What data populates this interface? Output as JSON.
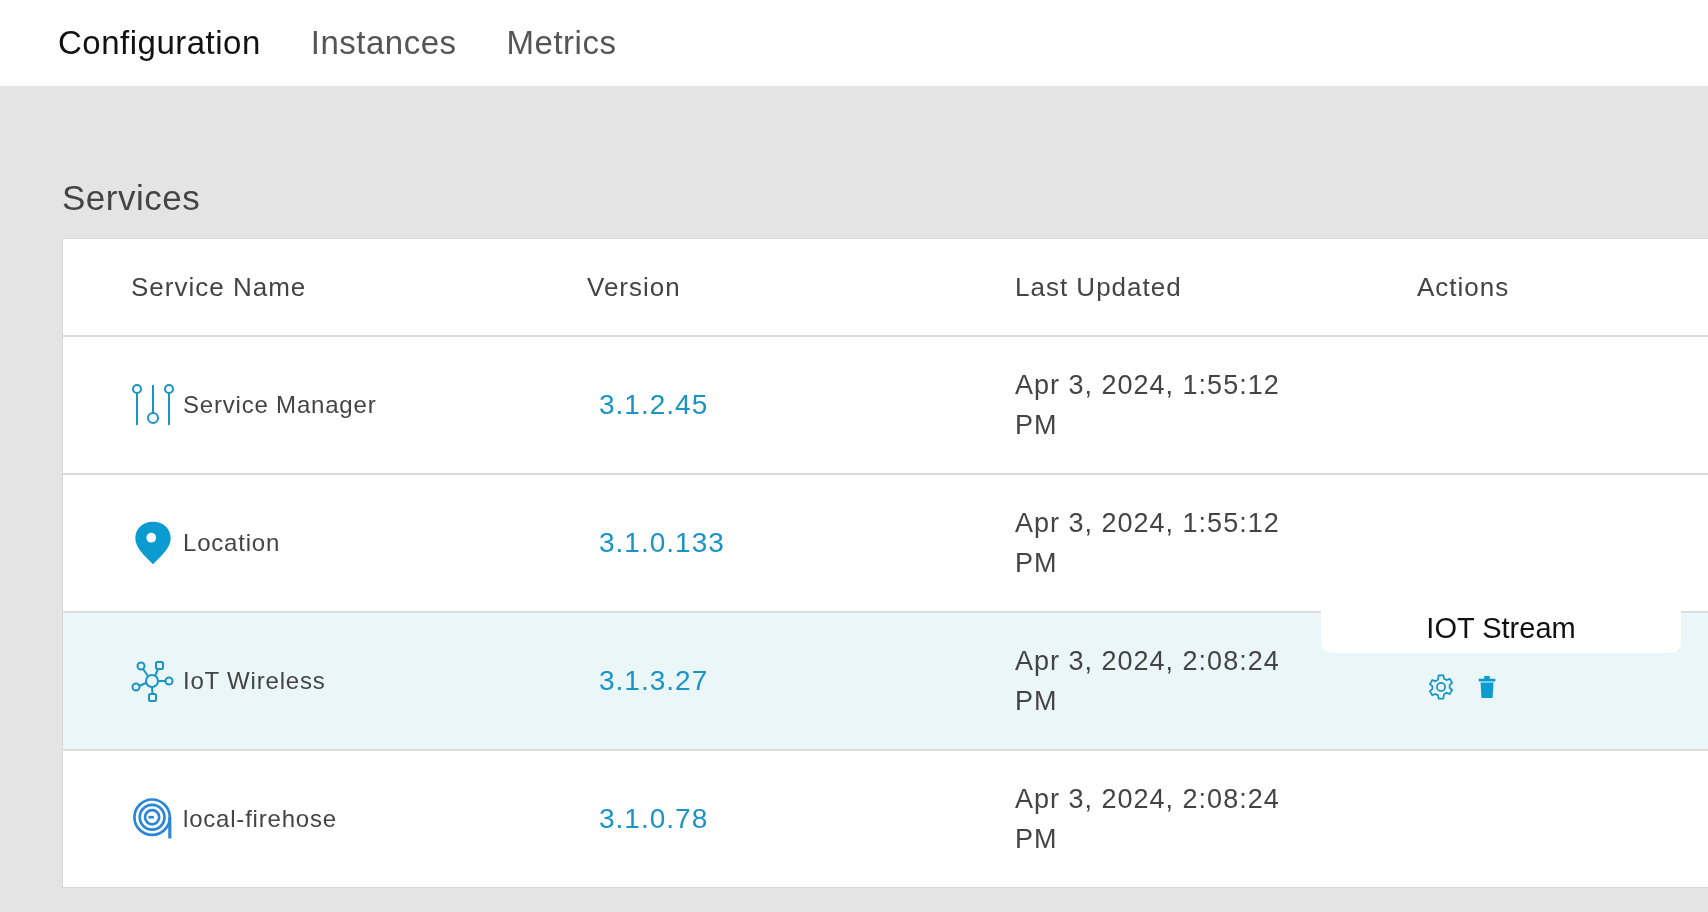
{
  "tabs": [
    {
      "label": "Configuration",
      "selected": true
    },
    {
      "label": "Instances",
      "selected": false
    },
    {
      "label": "Metrics",
      "selected": false
    }
  ],
  "section_title": "Services",
  "table": {
    "columns": [
      "Service Name",
      "Version",
      "Last Updated",
      "Actions"
    ],
    "rows": [
      {
        "kind": "sliders",
        "name": "Service Manager",
        "version": "3.1.2.45",
        "last_updated": "Apr 3, 2024, 1:55:12 PM",
        "selected": false
      },
      {
        "kind": "pin",
        "name": "Location",
        "version": "3.1.0.133",
        "last_updated": "Apr 3, 2024, 1:55:12 PM",
        "selected": false
      },
      {
        "kind": "network",
        "name": "IoT Wireless",
        "version": "3.1.3.27",
        "last_updated": "Apr 3, 2024, 2:08:24 PM",
        "selected": true,
        "tooltip": "IOT Stream"
      },
      {
        "kind": "spiral",
        "name": "local-firehose",
        "version": "3.1.0.78",
        "last_updated": "Apr 3, 2024, 2:08:24 PM",
        "selected": false
      }
    ]
  }
}
